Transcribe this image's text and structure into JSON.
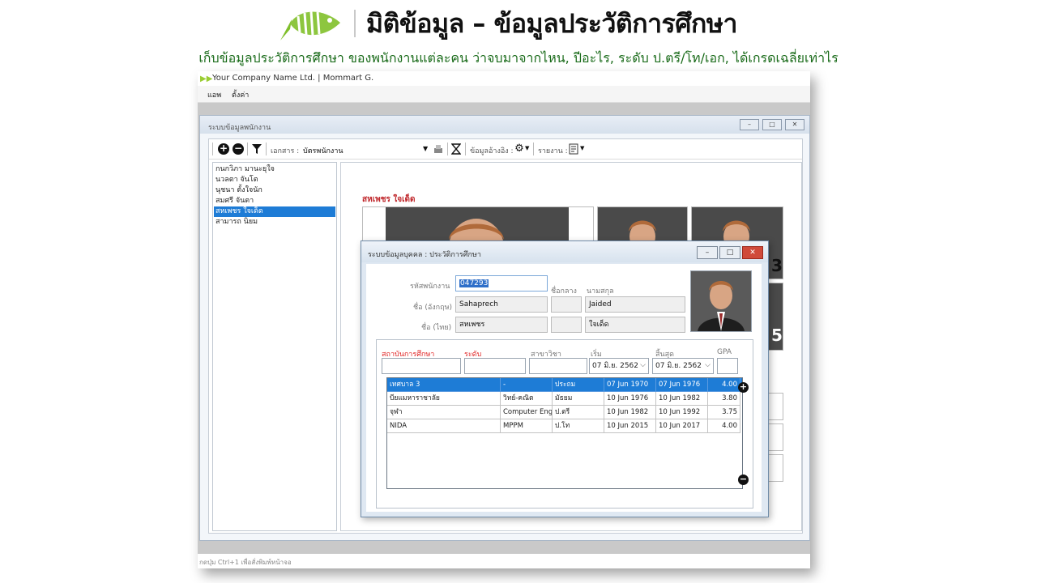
{
  "header": {
    "title": "มิติข้อมูล – ข้อมูลประวัติการศึกษา",
    "subtitle": "เก็บข้อมูลประวัติการศึกษา ของพนักงานแต่ละคน ว่าจบมาจากไหน, ปีอะไร, ระดับ ป.ตรี/โท/เอก, ได้เกรดเฉลี่ยเท่าไร",
    "logo_icon": "fish-logo-icon",
    "accent_color": "#8dc63f"
  },
  "app": {
    "title": "Your Company Name Ltd. | Mommart G.",
    "menu": [
      "แอพ",
      "ตั้งค่า"
    ],
    "status": "กดปุ่ม Ctrl+1 เพื่อสั่งพิมพ์หน้าจอ"
  },
  "child": {
    "title": "ระบบข้อมูลพนักงาน",
    "toolbar": {
      "doc_label": "เอกสาร :",
      "doc_value": "บัตรพนักงาน",
      "ref_label": "ข้อมูลอ้างอิง :",
      "report_label": "รายงาน :"
    },
    "employees": [
      "กนกวิภา มานะยุใจ",
      "นวลตา จันโต",
      "นุชนา ตั้งใจนัก",
      "สมศรี จันตา",
      "สหเพชร ใจเด็ด",
      "สามารถ นิยม"
    ],
    "selected_employee": "สหเพชร ใจเด็ด",
    "corner_numbers": [
      "3",
      "5"
    ]
  },
  "dialog": {
    "title": "ระบบข้อมูลบุคคล : ประวัติการศึกษา",
    "labels": {
      "emp_code": "รหัสพนักงาน",
      "middle_name": "ชื่อกลาง",
      "last_name": "นามสกุล",
      "name_en": "ชื่อ (อังกฤษ)",
      "name_th": "ชื่อ (ไทย)"
    },
    "values": {
      "emp_code": "047293",
      "first_en": "Sahaprech",
      "middle_en": "",
      "last_en": "Jaided",
      "first_th": "สหเพชร",
      "middle_th": "",
      "last_th": "ใจเด็ด"
    },
    "edu_headers": {
      "institution": "สถาบันการศึกษา",
      "level": "ระดับ",
      "major": "สาขาวิชา",
      "start": "เริ่ม",
      "end": "สิ้นสุด",
      "gpa": "GPA"
    },
    "edu_inputs": {
      "start_date": "07 มิ.ย.  2562",
      "end_date": "07 มิ.ย.  2562"
    },
    "rows": [
      {
        "institution": "เทศบาล 3",
        "level": "-",
        "major": "ประถม",
        "start": "07 Jun 1970",
        "end": "07 Jun 1976",
        "gpa": "4.00"
      },
      {
        "institution": "บียแมหาราชาลัย",
        "level": "วิทย์-คณิต",
        "major": "มัธยม",
        "start": "10 Jun 1976",
        "end": "10 Jun 1982",
        "gpa": "3.80"
      },
      {
        "institution": "จุฬา",
        "level": "Computer Eng",
        "major": "ป.ตรี",
        "start": "10 Jun 1982",
        "end": "10 Jun 1992",
        "gpa": "3.75"
      },
      {
        "institution": "NIDA",
        "level": "MPPM",
        "major": "ป.โท",
        "start": "10 Jun 2015",
        "end": "10 Jun 2017",
        "gpa": "4.00"
      }
    ],
    "selected_row": 0
  }
}
